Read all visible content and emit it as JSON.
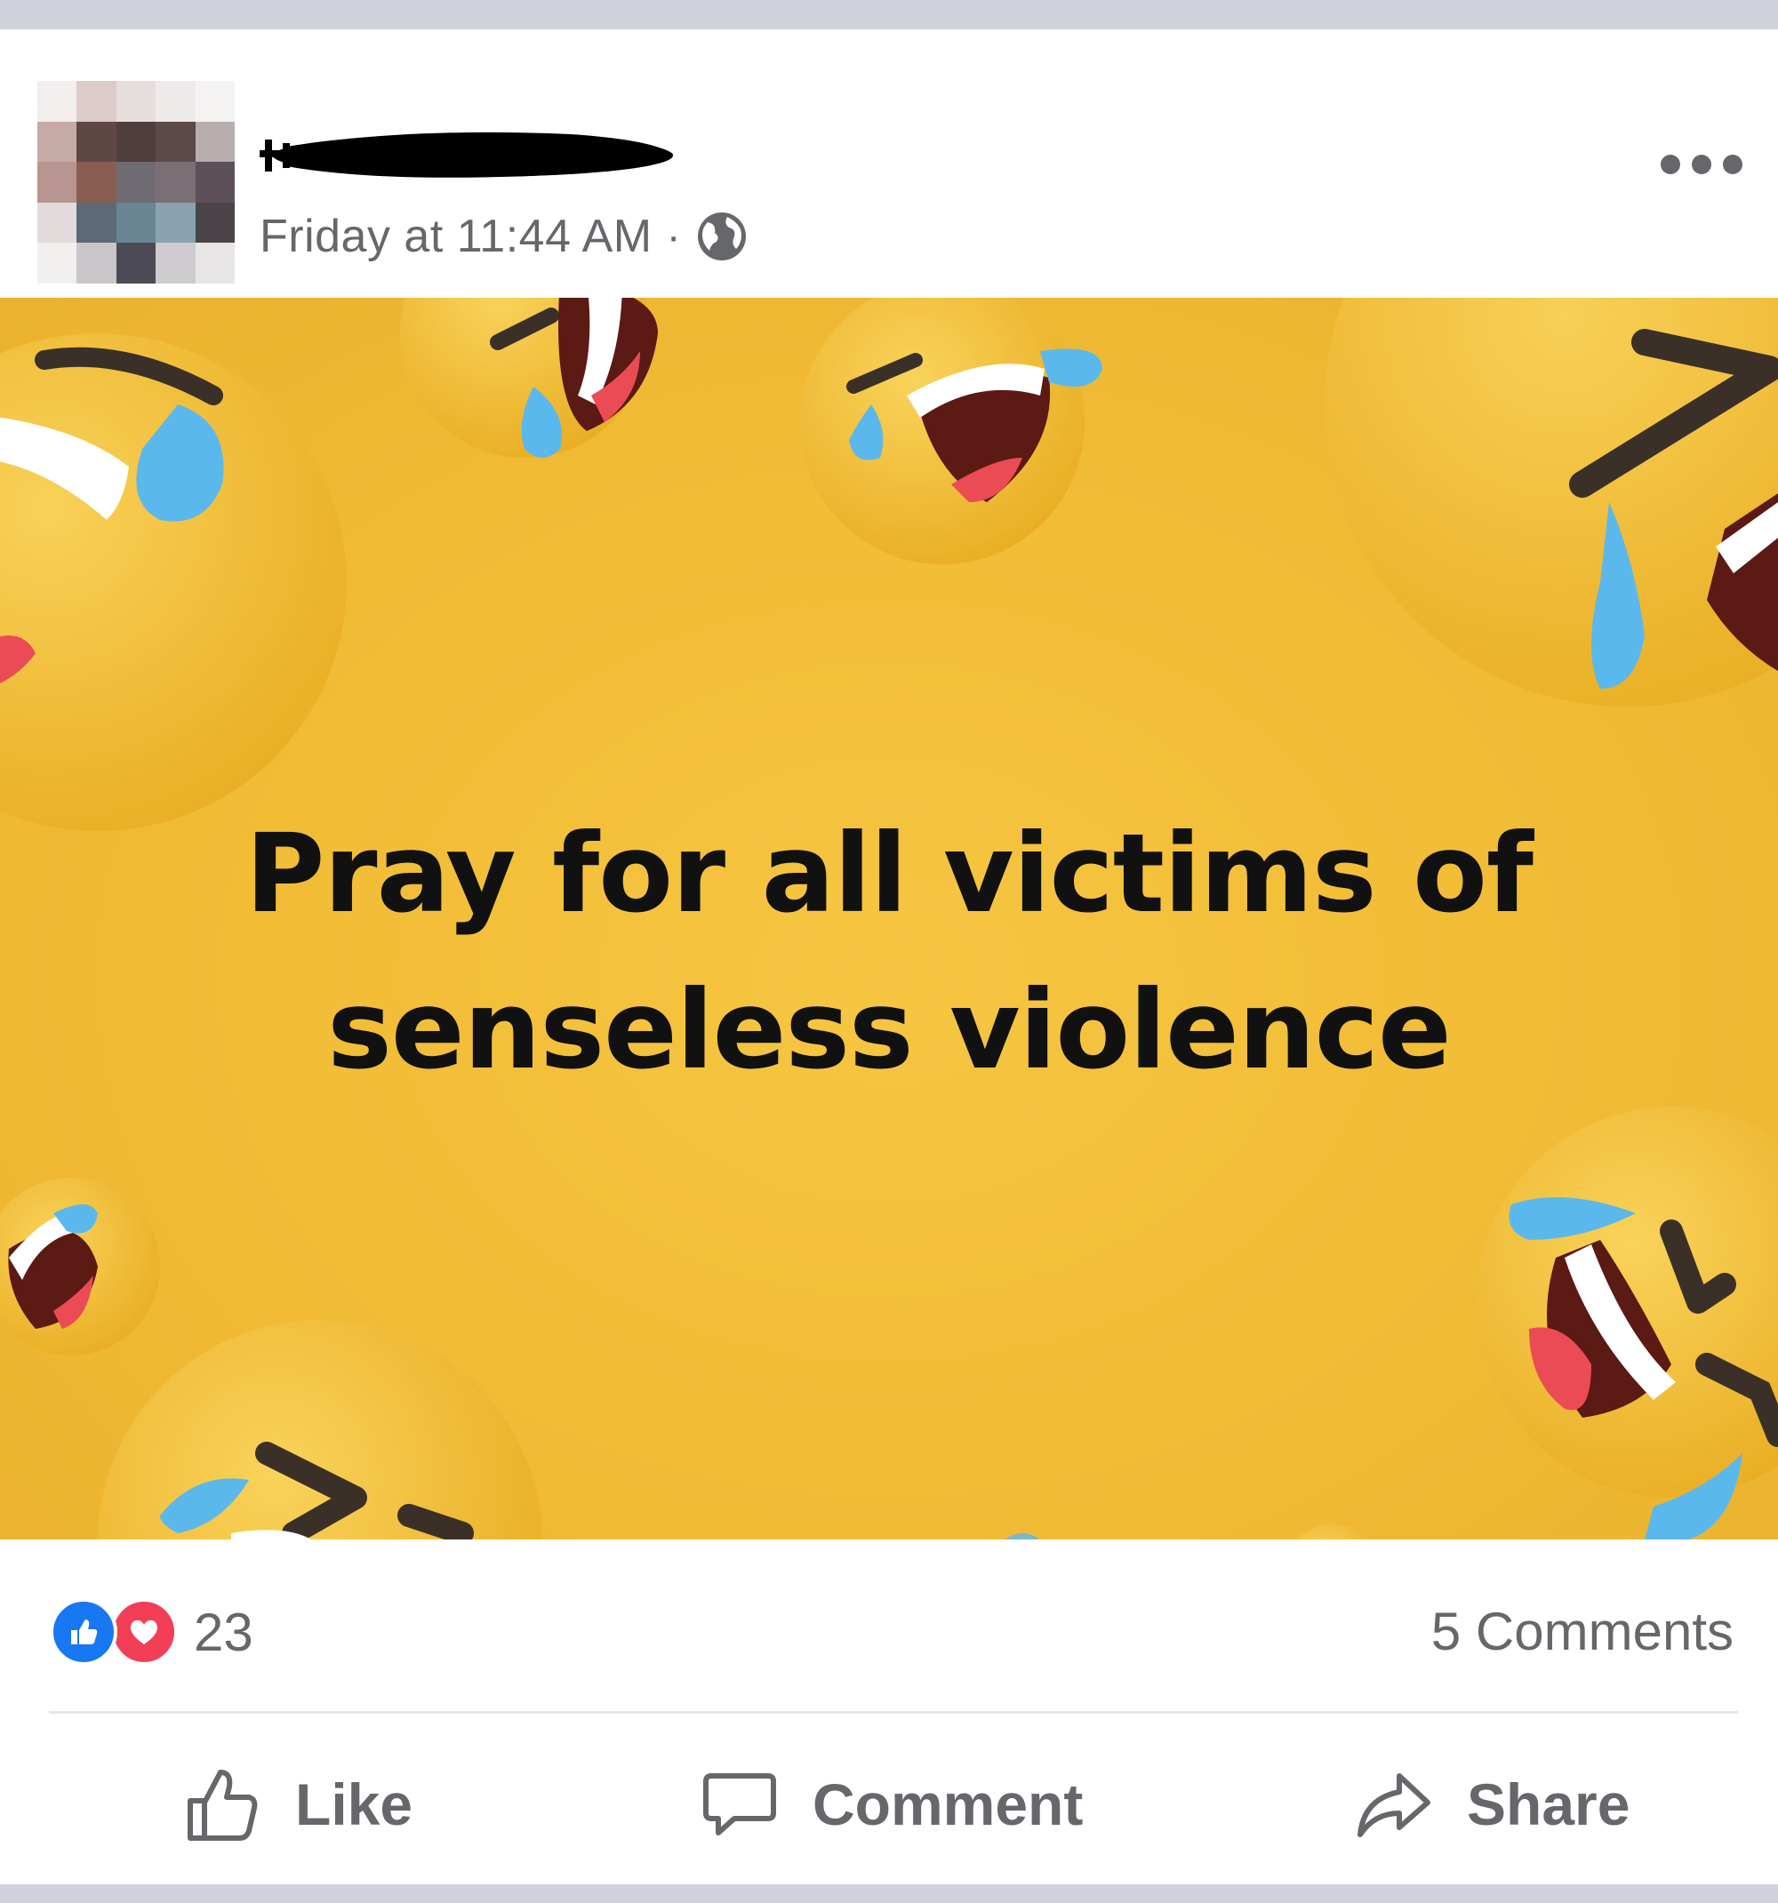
{
  "post": {
    "timestamp": "Friday at 11:44 AM",
    "separator": "·",
    "audience_icon": "globe-icon",
    "more_icon": "more-options-icon",
    "image_text_line1": "Pray for all victims of",
    "image_text_line2": "senseless violence",
    "reactions": {
      "icons": [
        "like-reaction-icon",
        "love-reaction-icon"
      ],
      "count": "23"
    },
    "comments_count": "5 Comments"
  },
  "actions": {
    "like_label": "Like",
    "comment_label": "Comment",
    "share_label": "Share"
  },
  "colors": {
    "background_yellow": "#f2bd37",
    "like_blue": "#1877f2",
    "love_red": "#f33e58",
    "secondary_text": "#65676b"
  }
}
